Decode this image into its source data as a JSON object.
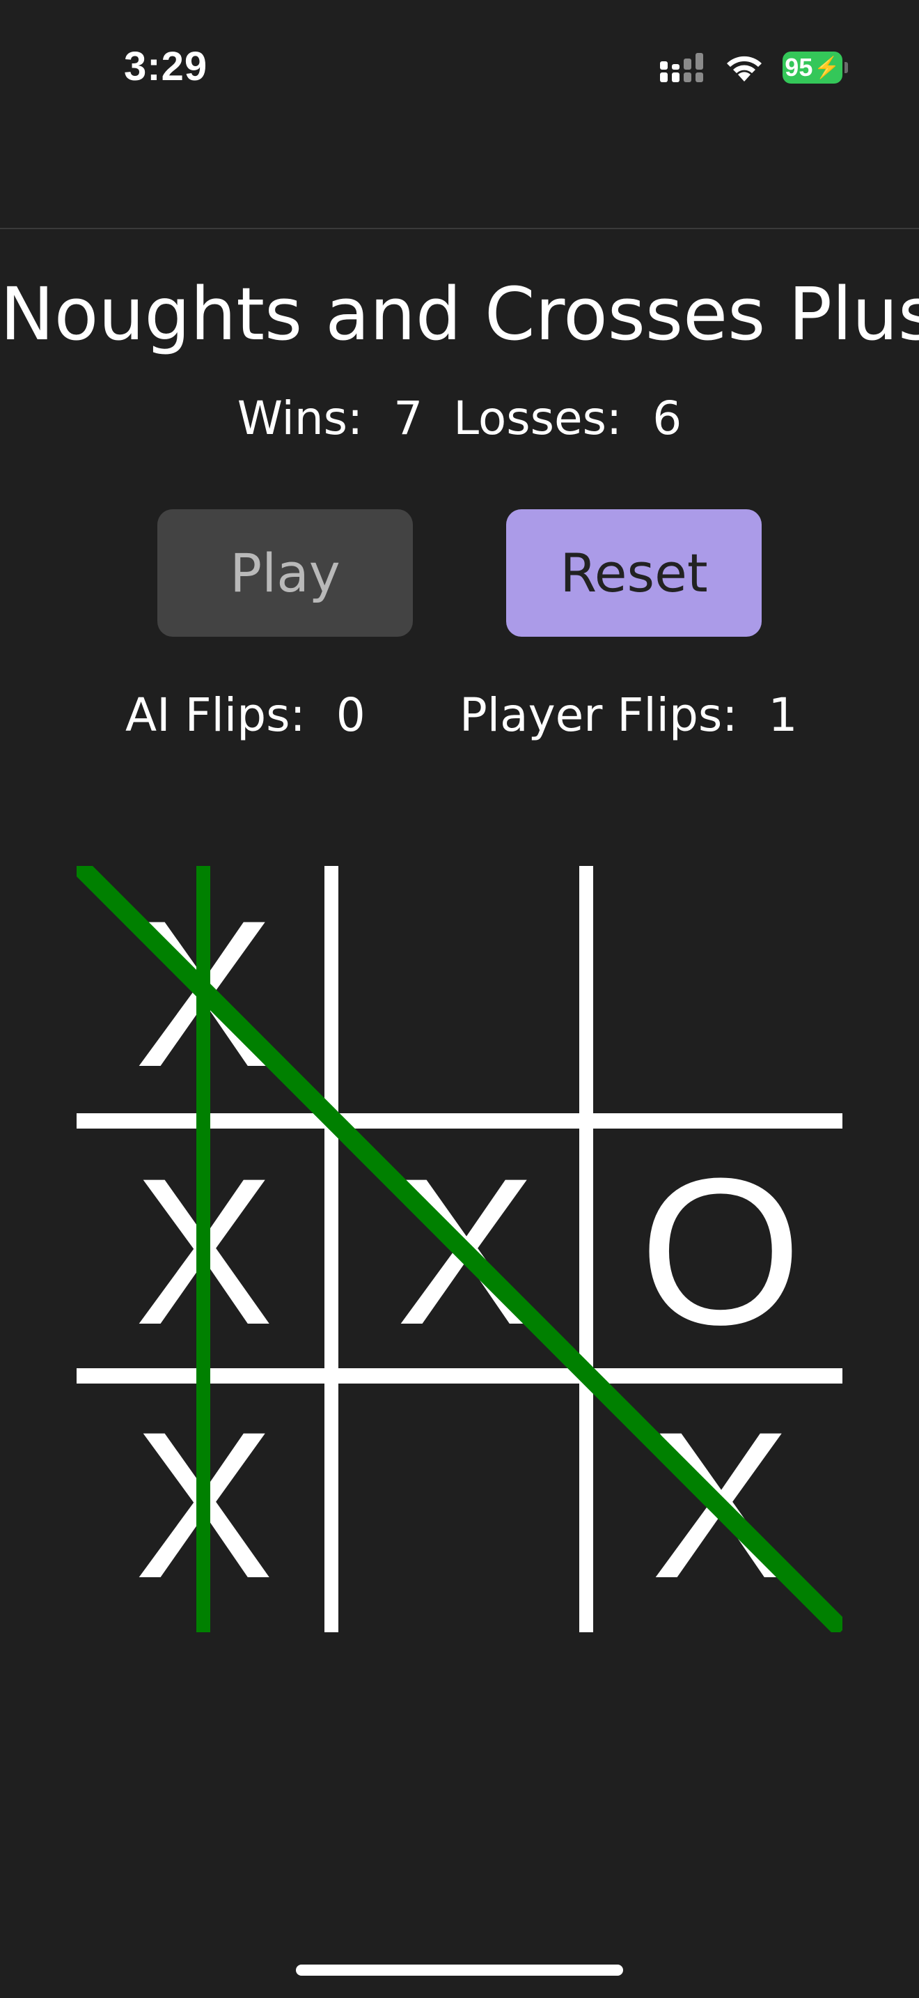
{
  "status_bar": {
    "time": "3:29",
    "battery_percent": "95",
    "icons": [
      "signal-icon",
      "wifi-icon",
      "battery-icon"
    ]
  },
  "title": "Noughts and Crosses Plus",
  "score": {
    "wins_label": "Wins:",
    "wins": "7",
    "losses_label": "Losses:",
    "losses": "6"
  },
  "buttons": {
    "play": "Play",
    "reset": "Reset"
  },
  "flips": {
    "ai_label": "AI Flips:",
    "ai": "0",
    "player_label": "Player Flips:",
    "player": "1"
  },
  "board": {
    "cells": [
      "X",
      "",
      "",
      "X",
      "X",
      "O",
      "X",
      "",
      "X"
    ],
    "winning_lines": [
      "column-1",
      "diagonal-top-left-to-bottom-right"
    ],
    "win_line_color": "#008000"
  },
  "colors": {
    "background": "#1f1f1f",
    "reset_button": "#ab9be8",
    "play_button": "#434343",
    "battery": "#34c759"
  }
}
